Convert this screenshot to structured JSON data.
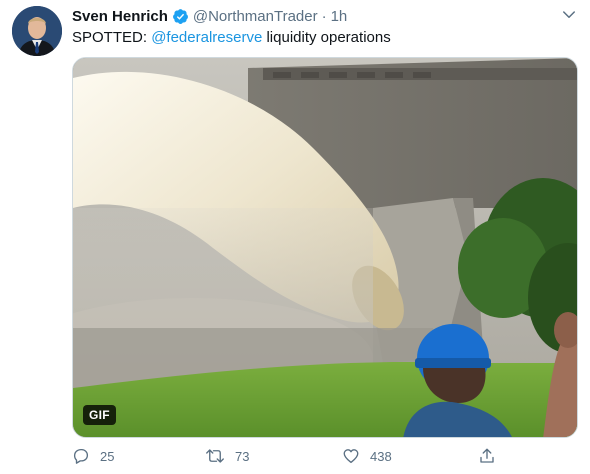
{
  "user": {
    "name": "Sven Henrich",
    "handle": "@NorthmanTrader",
    "separator": "·",
    "time": "1h"
  },
  "tweet": {
    "text_prefix": "SPOTTED: ",
    "mention": "@federalreserve",
    "text_suffix": " liquidity operations"
  },
  "media": {
    "badge": "GIF"
  },
  "actions": {
    "reply_count": "25",
    "retweet_count": "73",
    "like_count": "438"
  },
  "colors": {
    "link": "#1b95e0",
    "verified": "#1da1f2",
    "muted": "#5b7083"
  },
  "icons": [
    "caret-down-icon",
    "verified-badge-icon",
    "reply-icon",
    "retweet-icon",
    "like-icon",
    "share-icon"
  ]
}
